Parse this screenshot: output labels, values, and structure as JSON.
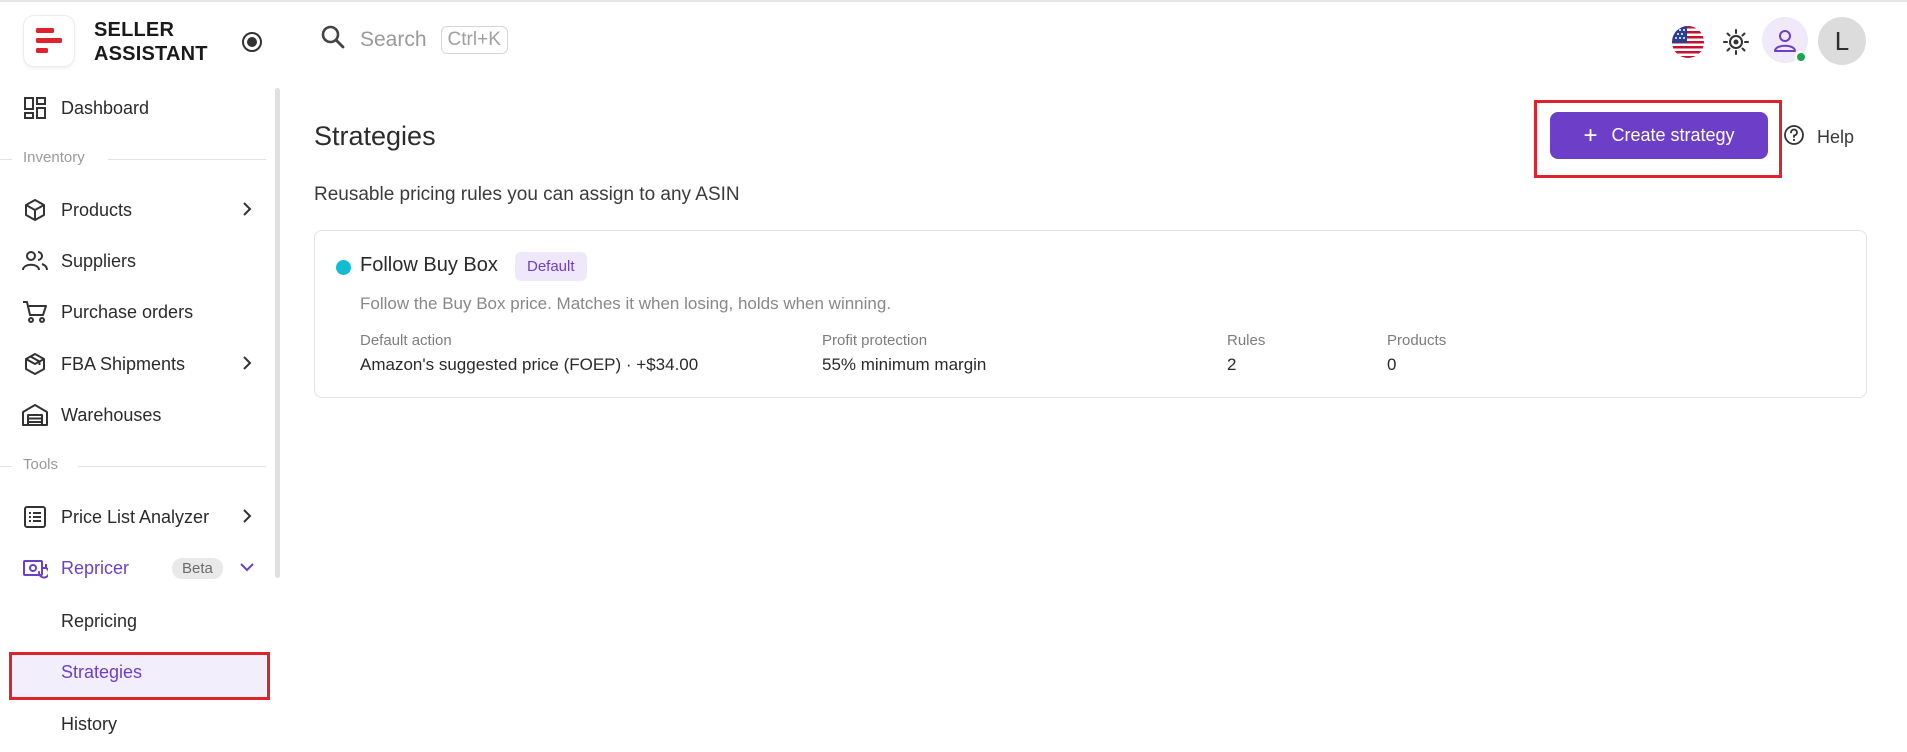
{
  "brand": {
    "line1": "SELLER",
    "line2": "ASSISTANT"
  },
  "search": {
    "placeholder": "Search",
    "shortcut": "Ctrl+K"
  },
  "user": {
    "avatar_letter": "L"
  },
  "sidebar": {
    "dashboard": "Dashboard",
    "section_inventory": "Inventory",
    "products": "Products",
    "suppliers": "Suppliers",
    "purchase_orders": "Purchase orders",
    "fba_shipments": "FBA Shipments",
    "warehouses": "Warehouses",
    "section_tools": "Tools",
    "price_list_analyzer": "Price List Analyzer",
    "repricer": "Repricer",
    "repricer_badge": "Beta",
    "repricing": "Repricing",
    "strategies": "Strategies",
    "history": "History"
  },
  "main": {
    "title": "Strategies",
    "subtitle": "Reusable pricing rules you can assign to any ASIN",
    "create_button": "Create strategy",
    "help": "Help"
  },
  "strategy_card": {
    "name": "Follow Buy Box",
    "badge": "Default",
    "description": "Follow the Buy Box price. Matches it when losing, holds when winning.",
    "status_color": "#14bcd3",
    "stats": [
      {
        "label": "Default action",
        "value": "Amazon's suggested price (FOEP) · +$34.00"
      },
      {
        "label": "Profit protection",
        "value": "55% minimum margin"
      },
      {
        "label": "Rules",
        "value": "2"
      },
      {
        "label": "Products",
        "value": "0"
      }
    ]
  },
  "colors": {
    "accent": "#6d3fc8",
    "highlight": "#e0212e"
  }
}
